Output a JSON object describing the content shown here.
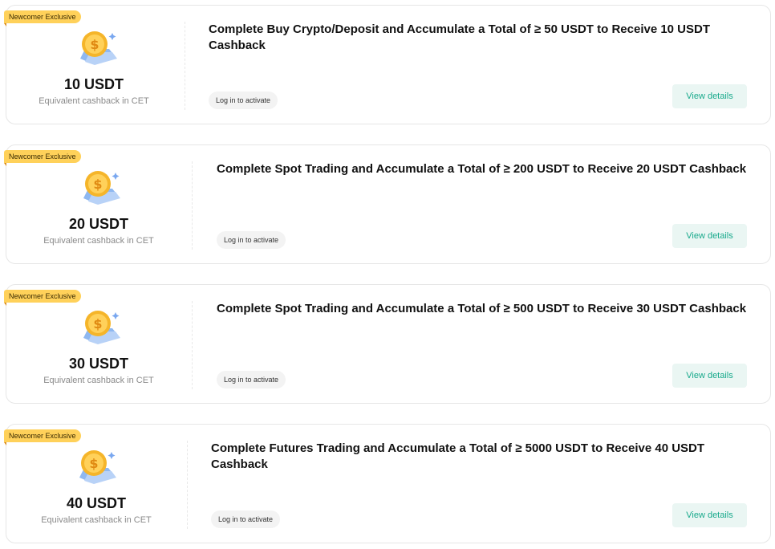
{
  "badge_text": "Newcomer Exclusive",
  "cards": [
    {
      "amount": "10 USDT",
      "sub": "Equivalent cashback in CET",
      "title": "Complete Buy Crypto/Deposit and Accumulate a Total of ≥ 50 USDT to Receive 10 USDT Cashback",
      "login": "Log in to activate",
      "view": "View details"
    },
    {
      "amount": "20 USDT",
      "sub": "Equivalent cashback in CET",
      "title": "Complete Spot Trading and Accumulate a Total of ≥ 200 USDT to Receive 20 USDT Cashback",
      "login": "Log in to activate",
      "view": "View details"
    },
    {
      "amount": "30 USDT",
      "sub": "Equivalent cashback in CET",
      "title": "Complete Spot Trading and Accumulate a Total of ≥ 500 USDT to Receive 30 USDT Cashback",
      "login": "Log in to activate",
      "view": "View details"
    },
    {
      "amount": "40 USDT",
      "sub": "Equivalent cashback in CET",
      "title": "Complete Futures Trading and Accumulate a Total of ≥ 5000 USDT to Receive 40 USDT Cashback",
      "login": "Log in to activate",
      "view": "View details"
    }
  ],
  "icons": {
    "coin": "coin-cashback-icon"
  },
  "colors": {
    "badge": "#ffd15a",
    "accent": "#17a98b",
    "button_bg": "#eaf6f3"
  }
}
